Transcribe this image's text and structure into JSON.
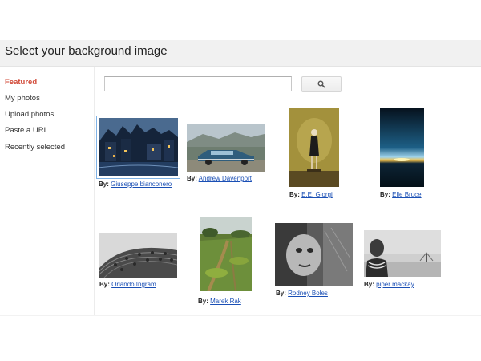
{
  "header": {
    "title": "Select your background image"
  },
  "sidebar": {
    "items": [
      {
        "label": "Featured",
        "active": true
      },
      {
        "label": "My photos"
      },
      {
        "label": "Upload photos"
      },
      {
        "label": "Paste a URL"
      },
      {
        "label": "Recently selected"
      }
    ]
  },
  "search": {
    "value": "",
    "placeholder": "",
    "button_icon": "search-icon"
  },
  "colors": {
    "active_tab": "#d14836",
    "link": "#1a4fb5",
    "selected_outline": "#7fb2e6"
  },
  "gallery": {
    "by_label": "By:",
    "images": [
      {
        "author": "Giuseppe bianconero",
        "subject": "night-village",
        "selected": true
      },
      {
        "author": "Andrew Davenport",
        "subject": "vintage-car"
      },
      {
        "author": "E.E. Giorgi",
        "subject": "woman-statue"
      },
      {
        "author": "Elle Bruce",
        "subject": "sunset-horizon"
      },
      {
        "author": "Orlando Ingram",
        "subject": "architecture-curve"
      },
      {
        "author": "Marek Rak",
        "subject": "green-field"
      },
      {
        "author": "Rodney Boles",
        "subject": "bw-face"
      },
      {
        "author": "piper mackay",
        "subject": "tribal-portrait"
      }
    ]
  }
}
